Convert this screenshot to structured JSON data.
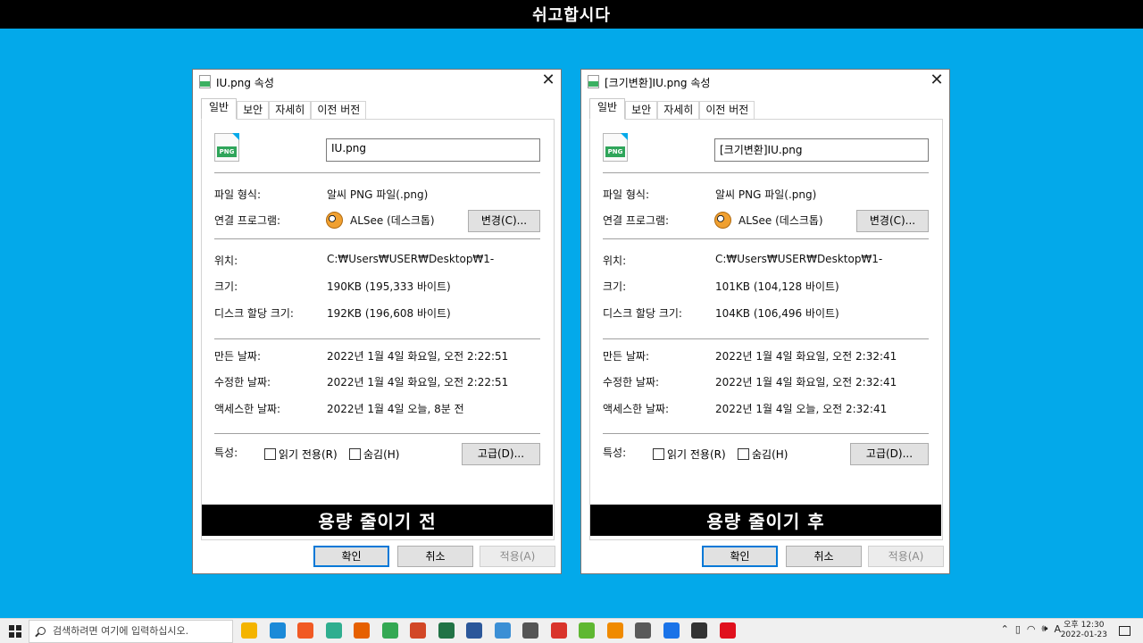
{
  "banner": {
    "text": "쉬고합시다"
  },
  "dialogs": [
    {
      "title": "IU.png 속성",
      "tabs": [
        "일반",
        "보안",
        "자세히",
        "이전 버전"
      ],
      "file_icon_text": "PNG",
      "filename": "IU.png",
      "file_type_label": "파일 형식:",
      "file_type_value": "알씨 PNG 파일(.png)",
      "open_with_label": "연결 프로그램:",
      "open_with_value": "ALSee (데스크톱)",
      "change_button": "변경(C)...",
      "location_label": "위치:",
      "location_value": "C:₩Users₩USER₩Desktop₩1-",
      "size_label": "크기:",
      "size_value": "190KB (195,333 바이트)",
      "disk_size_label": "디스크 할당 크기:",
      "disk_size_value": "192KB (196,608 바이트)",
      "created_label": "만든 날짜:",
      "created_value": "2022년 1월 4일 화요일, 오전 2:22:51",
      "modified_label": "수정한 날짜:",
      "modified_value": "2022년 1월 4일 화요일, 오전 2:22:51",
      "accessed_label": "액세스한 날짜:",
      "accessed_value": "2022년 1월 4일 오늘, 8분 전",
      "attributes_label": "특성:",
      "readonly_label": "읽기 전용(R)",
      "hidden_label": "숨김(H)",
      "advanced_button": "고급(D)...",
      "caption": "용량 줄이기 전",
      "ok_button": "확인",
      "cancel_button": "취소",
      "apply_button": "적용(A)"
    },
    {
      "title": "[크기변환]IU.png 속성",
      "tabs": [
        "일반",
        "보안",
        "자세히",
        "이전 버전"
      ],
      "file_icon_text": "PNG",
      "filename": "[크기변환]IU.png",
      "file_type_label": "파일 형식:",
      "file_type_value": "알씨 PNG 파일(.png)",
      "open_with_label": "연결 프로그램:",
      "open_with_value": "ALSee (데스크톱)",
      "change_button": "변경(C)...",
      "location_label": "위치:",
      "location_value": "C:₩Users₩USER₩Desktop₩1-",
      "size_label": "크기:",
      "size_value": "101KB (104,128 바이트)",
      "disk_size_label": "디스크 할당 크기:",
      "disk_size_value": "104KB (106,496 바이트)",
      "created_label": "만든 날짜:",
      "created_value": "2022년 1월 4일 화요일, 오전 2:32:41",
      "modified_label": "수정한 날짜:",
      "modified_value": "2022년 1월 4일 화요일, 오전 2:32:41",
      "accessed_label": "액세스한 날짜:",
      "accessed_value": "2022년 1월 4일 오늘, 오전 2:32:41",
      "attributes_label": "특성:",
      "readonly_label": "읽기 전용(R)",
      "hidden_label": "숨김(H)",
      "advanced_button": "고급(D)...",
      "caption": "용량 줄이기 후",
      "ok_button": "확인",
      "cancel_button": "취소",
      "apply_button": "적용(A)"
    }
  ],
  "taskbar": {
    "search_placeholder": "검색하려면 여기에 입력하십시오.",
    "apps": [
      {
        "name": "file-explorer-icon",
        "color": "#f4b400"
      },
      {
        "name": "edge-icon",
        "color": "#1b8ad8"
      },
      {
        "name": "brave-icon",
        "color": "#f15a24"
      },
      {
        "name": "app-icon",
        "color": "#2fae8f"
      },
      {
        "name": "firefox-icon",
        "color": "#e66000"
      },
      {
        "name": "chrome-icon",
        "color": "#34a853"
      },
      {
        "name": "powerpoint-icon",
        "color": "#d24726"
      },
      {
        "name": "excel-icon",
        "color": "#217346"
      },
      {
        "name": "word-icon",
        "color": "#2b579a"
      },
      {
        "name": "remote-desktop-icon",
        "color": "#3b8fd5"
      },
      {
        "name": "search-app-icon",
        "color": "#555555"
      },
      {
        "name": "se-app-icon",
        "color": "#d9342b"
      },
      {
        "name": "green-app-icon",
        "color": "#5fb832"
      },
      {
        "name": "vlc-icon",
        "color": "#f08a00"
      },
      {
        "name": "calculator-icon",
        "color": "#5a5a5a"
      },
      {
        "name": "chrome-dev-icon",
        "color": "#1a73e8"
      },
      {
        "name": "sticky-notes-icon",
        "color": "#333333"
      },
      {
        "name": "opera-icon",
        "color": "#e0101d"
      }
    ],
    "tray_lang": "A",
    "clock_time": "오후 12:30",
    "clock_date": "2022-01-23"
  }
}
